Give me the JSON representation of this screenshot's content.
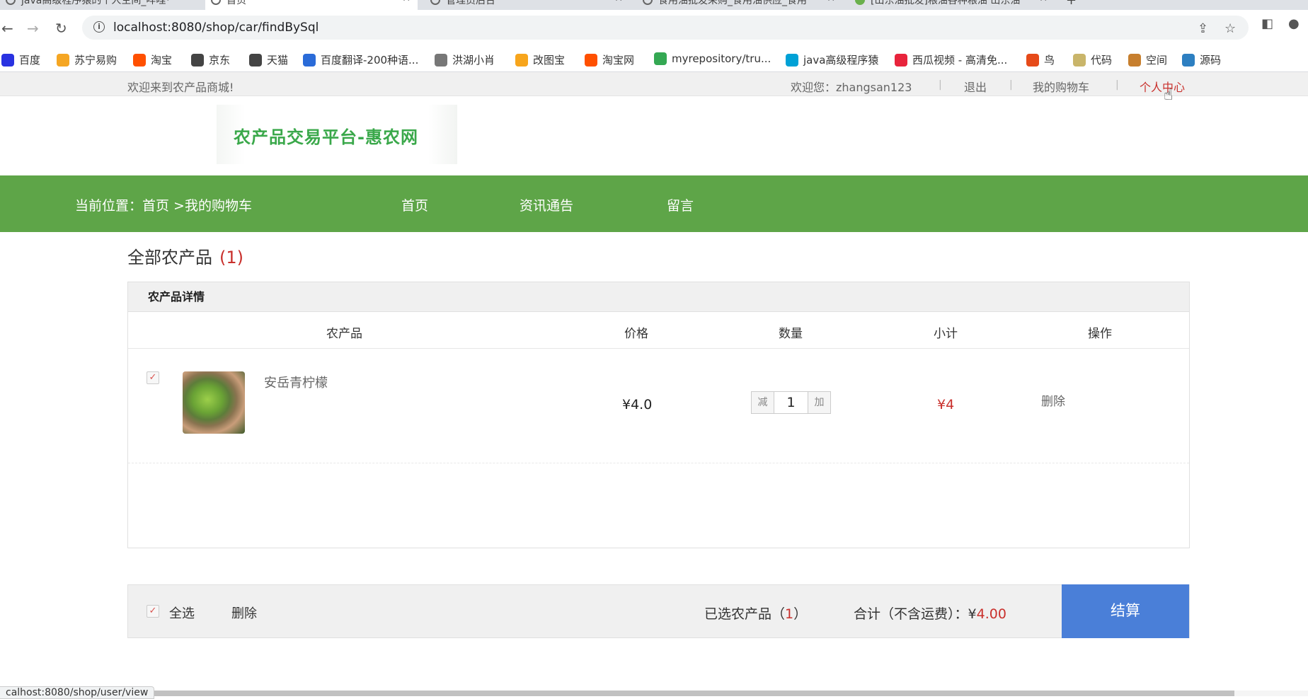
{
  "browser": {
    "tabs": [
      {
        "title": "java高级程序猿的个人空间_哔哩"
      },
      {
        "title": "首页"
      },
      {
        "title": "管理员后台"
      },
      {
        "title": "食用油批发采购_食用油供应_食用"
      },
      {
        "title": "[山东油批发]粮油各种粮油 山东油"
      }
    ],
    "url": "localhost:8080/shop/car/findBySql",
    "bookmarks": [
      {
        "label": "百度",
        "color": "#2932e1"
      },
      {
        "label": "苏宁易购",
        "color": "#f5a623"
      },
      {
        "label": "淘宝",
        "color": "#ff5000"
      },
      {
        "label": "京东",
        "color": "#444444"
      },
      {
        "label": "天猫",
        "color": "#444444"
      },
      {
        "label": "百度翻译-200种语...",
        "color": "#2a6bd8"
      },
      {
        "label": "洪湖小肖",
        "color": "#777777"
      },
      {
        "label": "改图宝",
        "color": "#f7a51c"
      },
      {
        "label": "淘宝网",
        "color": "#ff5000"
      },
      {
        "label": "myrepository/tru...",
        "color": "#34a853"
      },
      {
        "label": "java高级程序猿",
        "color": "#00a1d6"
      },
      {
        "label": "西瓜视频 - 高清免...",
        "color": "#e8243c"
      },
      {
        "label": "鸟",
        "color": "#e64a19"
      },
      {
        "label": "代码",
        "color": "#c9b56a"
      },
      {
        "label": "空间",
        "color": "#c77f2e"
      },
      {
        "label": "源码",
        "color": "#2d7fc1"
      }
    ]
  },
  "site_top": {
    "welcome": "欢迎来到农产品商城!",
    "user_greeting": "欢迎您：zhangsan123",
    "logout": "退出",
    "my_cart": "我的购物车",
    "personal_center": "个人中心",
    "separator": "|"
  },
  "logo": {
    "text": "农产品交易平台-惠农网"
  },
  "nav": {
    "breadcrumb": "当前位置：首页 >我的购物车",
    "links": [
      "首页",
      "资讯通告",
      "留言"
    ]
  },
  "cart": {
    "section_title": "全部农产品",
    "section_count": "(1)",
    "panel_title": "农产品详情",
    "columns": [
      "农产品",
      "价格",
      "数量",
      "小计",
      "操作"
    ],
    "items": [
      {
        "name": "安岳青柠檬",
        "price": "¥4.0",
        "quantity": "1",
        "minus_label": "减",
        "plus_label": "加",
        "subtotal": "¥4",
        "action": "删除",
        "checked": true
      }
    ],
    "footer": {
      "select_all": "全选",
      "delete": "删除",
      "selected_prefix": "已选农产品（",
      "selected_count": "1",
      "selected_suffix": "）",
      "total_label": "合计（不含运费）：",
      "total_currency": "¥",
      "total_value": "4.00",
      "checkout": "结算"
    }
  },
  "status_bar": "calhost:8080/shop/user/view"
}
